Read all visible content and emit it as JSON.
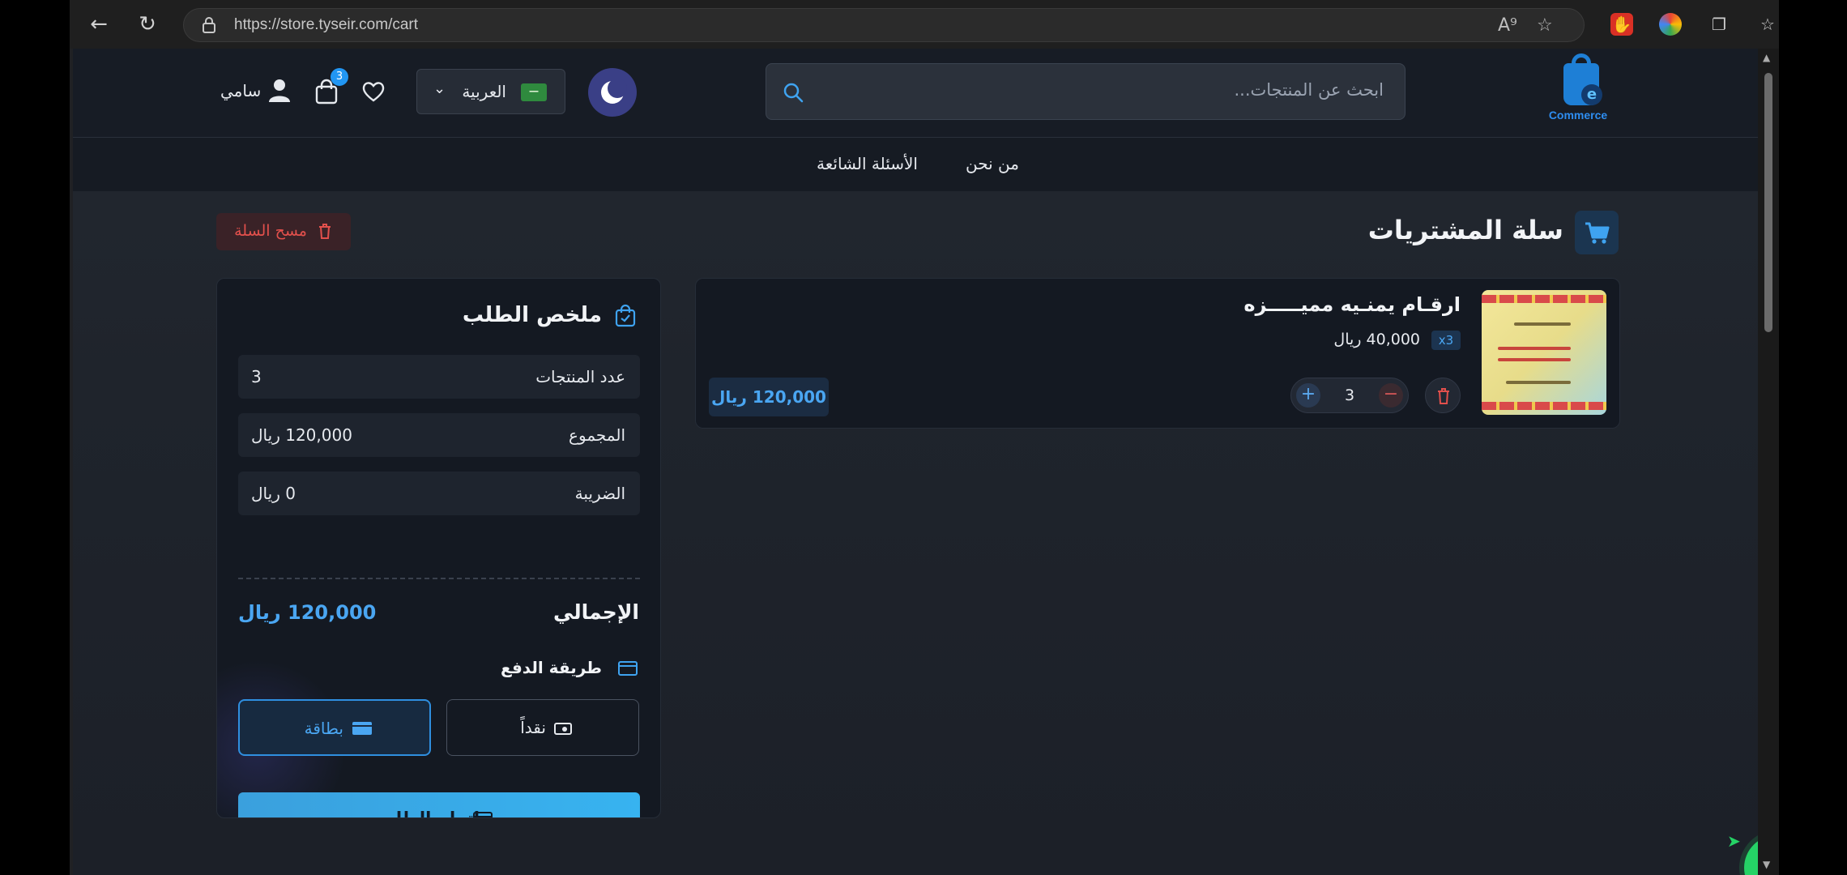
{
  "browser": {
    "url": "https://store.tyseir.com/cart"
  },
  "header": {
    "logo_text": "Commerce",
    "search_placeholder": "ابحث عن المنتجات...",
    "language_label": "العربية",
    "cart_count": "3",
    "user_name": "سامي"
  },
  "subnav": {
    "about": "من نحن",
    "faq": "الأسئلة الشائعة"
  },
  "cart": {
    "title": "سلة المشتريات",
    "clear_label": "مسح السلة",
    "items": [
      {
        "name": "ارقـام يمنـيه مميـــــزه",
        "quantity_tag": "x3",
        "unit_price": "40,000 ريال",
        "quantity": "3",
        "line_total": "120,000 ريال"
      }
    ]
  },
  "summary": {
    "title": "ملخص الطلب",
    "rows": [
      {
        "label": "عدد المنتجات",
        "value": "3"
      },
      {
        "label": "المجموع",
        "value": "120,000 ريال"
      },
      {
        "label": "الضريبة",
        "value": "0 ريال"
      }
    ],
    "total_label": "الإجمالي",
    "total_value": "120,000 ريال",
    "payment_title": "طريقة الدفع",
    "payment_cash": "نقداً",
    "payment_card": "بطاقة",
    "checkout_label": "إتمام الطلب"
  },
  "colors": {
    "accent": "#4aa6f2",
    "danger": "#e2504c",
    "whatsapp": "#25d366"
  }
}
